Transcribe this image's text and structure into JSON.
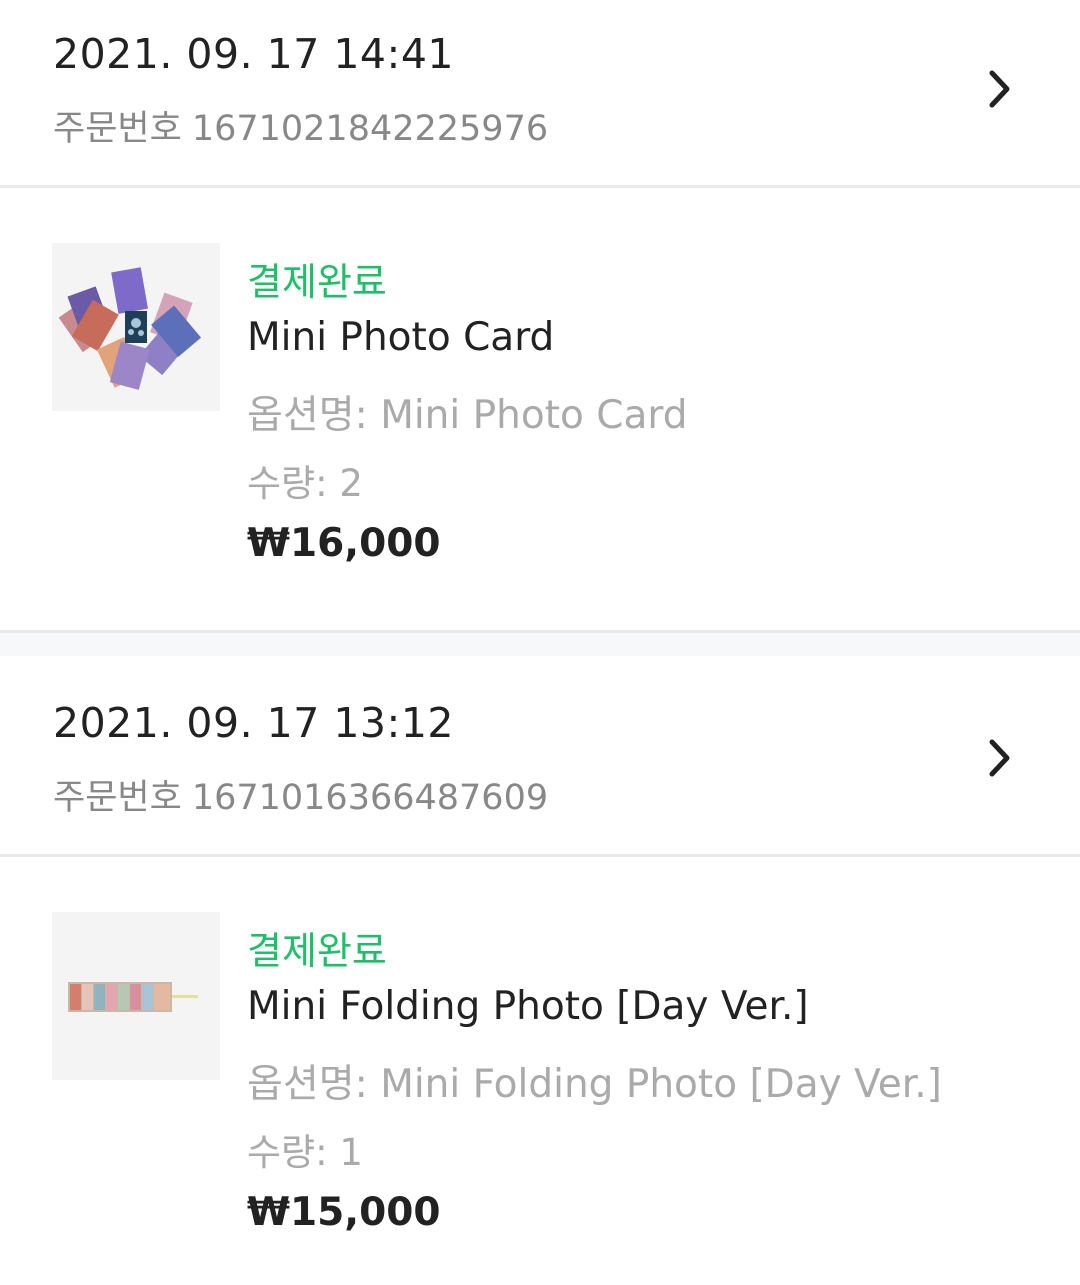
{
  "orders": [
    {
      "date": "2021. 09. 17 14:41",
      "order_number_label": "주문번호",
      "order_number": "1671021842225976",
      "item": {
        "status": "결제완료",
        "name": "Mini  Photo Card",
        "option_label": "옵션명:",
        "option_value": "Mini  Photo Card",
        "quantity_label": "수량:",
        "quantity": "2",
        "price": "₩16,000"
      }
    },
    {
      "date": "2021. 09. 17 13:12",
      "order_number_label": "주문번호",
      "order_number": "1671016366487609",
      "item": {
        "status": "결제완료",
        "name": "Mini Folding Photo [Day Ver.]",
        "option_label": "옵션명:",
        "option_value": "Mini Folding Photo [Day Ver.]",
        "quantity_label": "수량:",
        "quantity": "1",
        "price": "₩15,000"
      }
    }
  ],
  "icons": {
    "detail": "chevron-right-icon"
  },
  "colors": {
    "status_green": "#1fbf6a",
    "primary_text": "#222222",
    "secondary_text": "#888888",
    "muted_text": "#aaaaaa",
    "divider": "#e8e9eb",
    "thumb_bg": "#f4f4f4"
  }
}
